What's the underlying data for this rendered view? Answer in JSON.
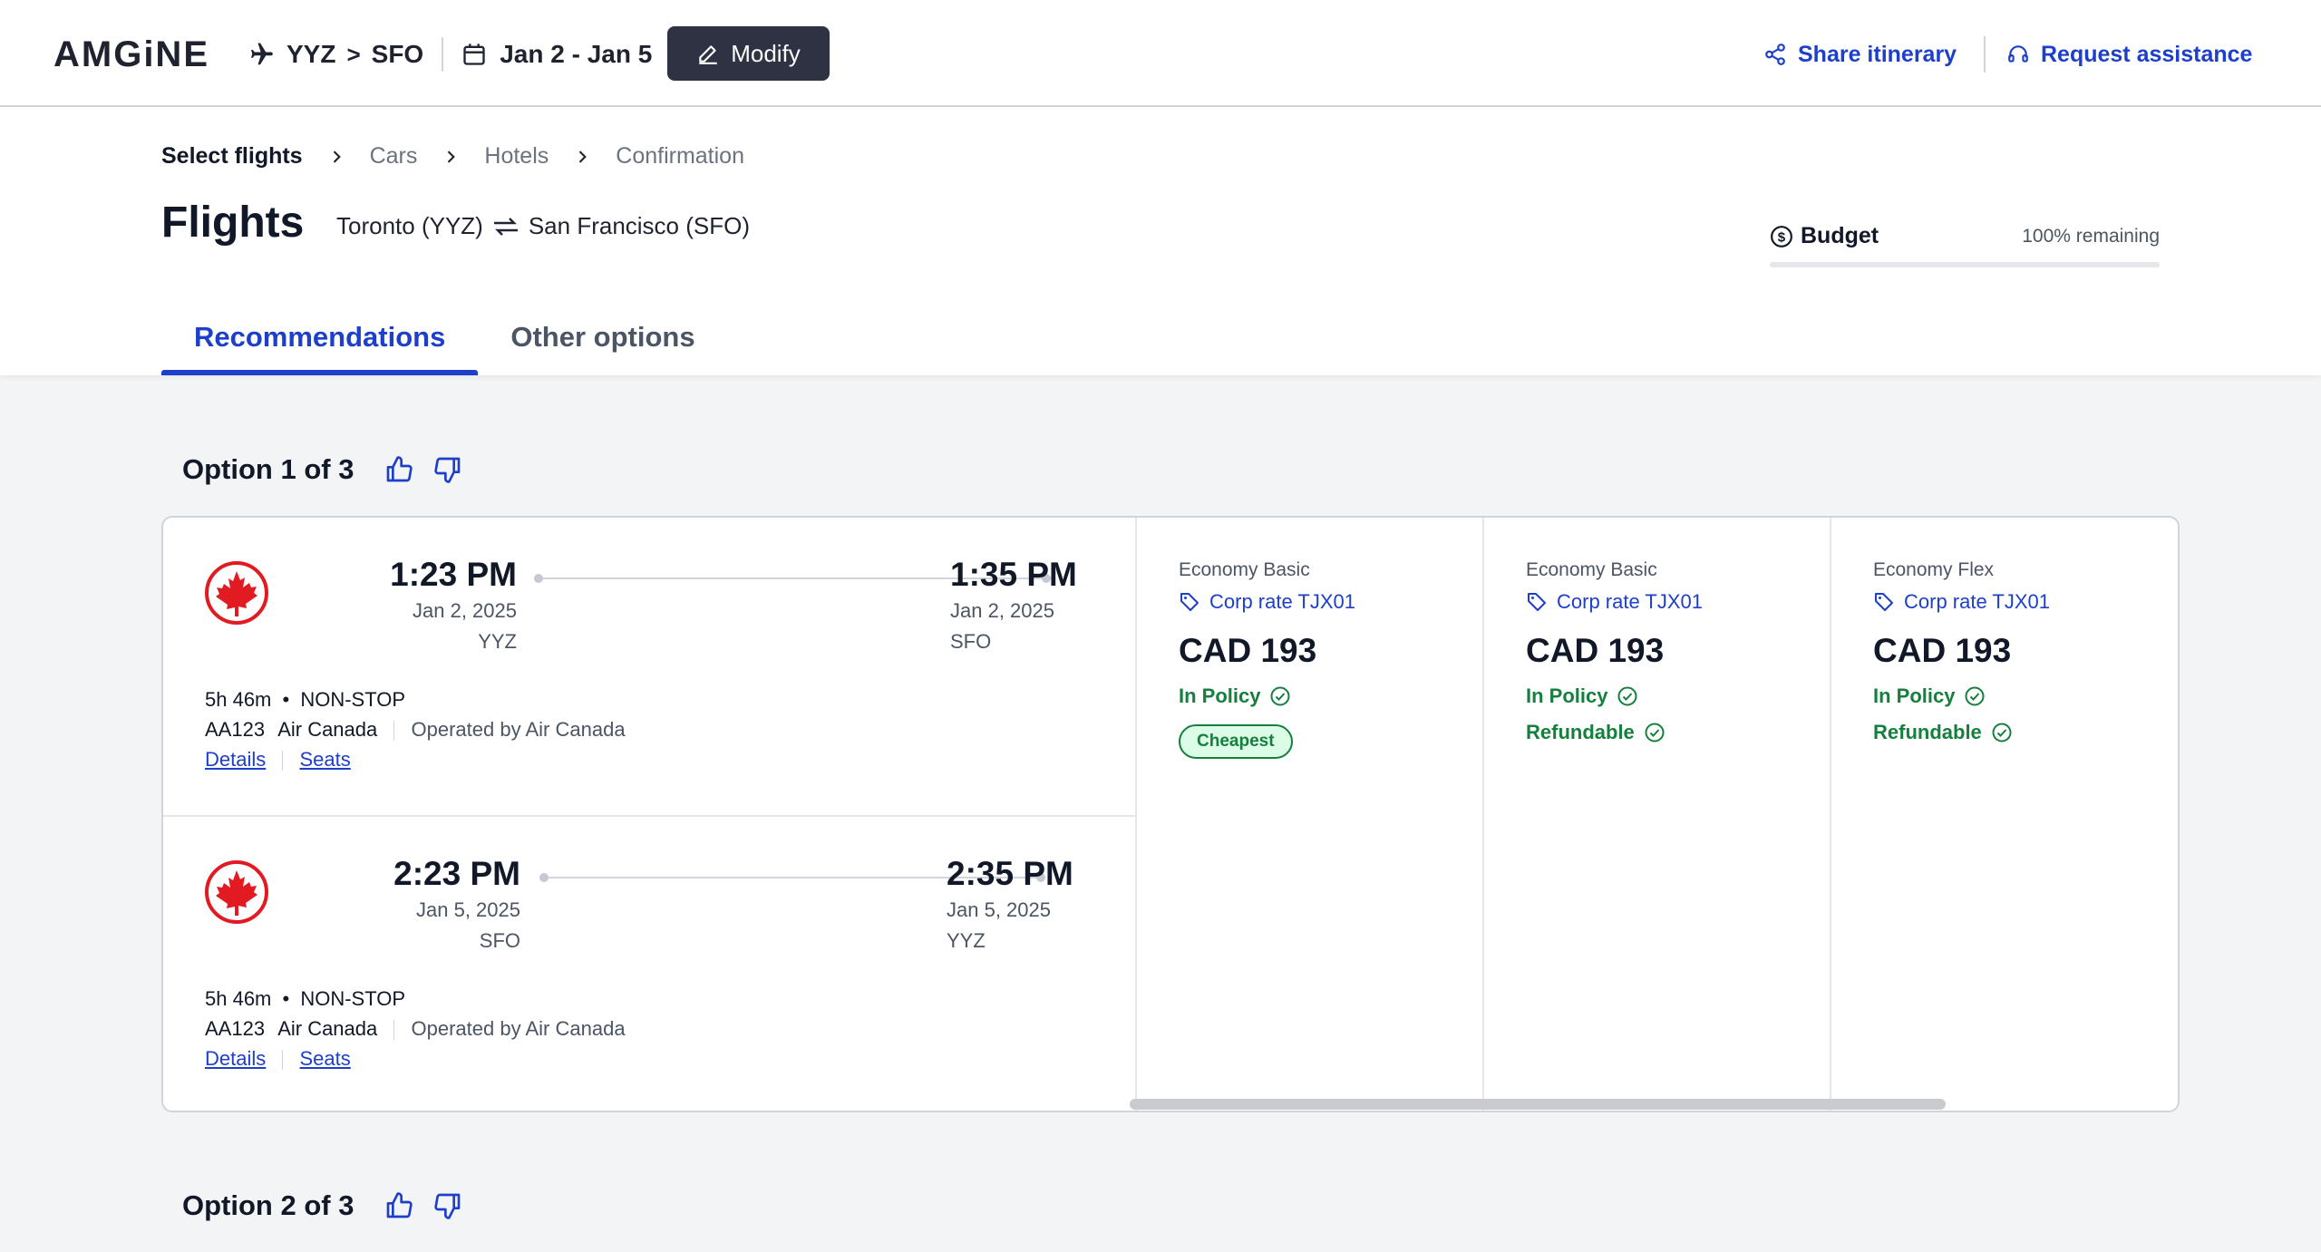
{
  "header": {
    "logo": "AMGiNE",
    "origin": "YYZ",
    "destination": "SFO",
    "route_sep": ">",
    "dates": "Jan 2 - Jan 5",
    "modify_label": "Modify",
    "share_label": "Share itinerary",
    "assist_label": "Request assistance"
  },
  "breadcrumbs": [
    {
      "label": "Select flights"
    },
    {
      "label": "Cars"
    },
    {
      "label": "Hotels"
    },
    {
      "label": "Confirmation"
    }
  ],
  "page": {
    "title": "Flights",
    "from": "Toronto (YYZ)",
    "to": "San Francisco (SFO)"
  },
  "budget": {
    "label": "Budget",
    "remaining": "100% remaining",
    "remaining_fraction": 1.0
  },
  "tabs": [
    {
      "label": "Recommendations",
      "active": true
    },
    {
      "label": "Other options",
      "active": false
    }
  ],
  "options": [
    {
      "title": "Option 1 of 3",
      "legs": [
        {
          "dep_time": "1:23 PM",
          "dep_date": "Jan 2, 2025",
          "dep_code": "YYZ",
          "arr_time": "1:35 PM",
          "arr_date": "Jan 2, 2025",
          "arr_code": "SFO",
          "duration": "5h 46m",
          "bullet": "•",
          "stops": "NON-STOP",
          "flight_no": "AA123",
          "airline": "Air Canada",
          "operated": "Operated by Air Canada",
          "details": "Details",
          "seats": "Seats"
        },
        {
          "dep_time": "2:23 PM",
          "dep_date": "Jan 5, 2025",
          "dep_code": "SFO",
          "arr_time": "2:35 PM",
          "arr_date": "Jan 5, 2025",
          "arr_code": "YYZ",
          "duration": "5h 46m",
          "bullet": "•",
          "stops": "NON-STOP",
          "flight_no": "AA123",
          "airline": "Air Canada",
          "operated": "Operated by Air Canada",
          "details": "Details",
          "seats": "Seats"
        }
      ],
      "fares": [
        {
          "class": "Economy Basic",
          "corp": "Corp rate TJX01",
          "price": "CAD 193",
          "policy": "In Policy",
          "refundable": "",
          "badge": "Cheapest"
        },
        {
          "class": "Economy Basic",
          "corp": "Corp rate TJX01",
          "price": "CAD 193",
          "policy": "In Policy",
          "refundable": "Refundable",
          "badge": ""
        },
        {
          "class": "Economy Flex",
          "corp": "Corp rate TJX01",
          "price": "CAD 193",
          "policy": "In Policy",
          "refundable": "Refundable",
          "badge": ""
        }
      ]
    },
    {
      "title": "Option 2 of 3"
    }
  ],
  "colors": {
    "accent": "#1d3fc9",
    "success": "#15803d",
    "air_canada_red": "#e21b23"
  }
}
